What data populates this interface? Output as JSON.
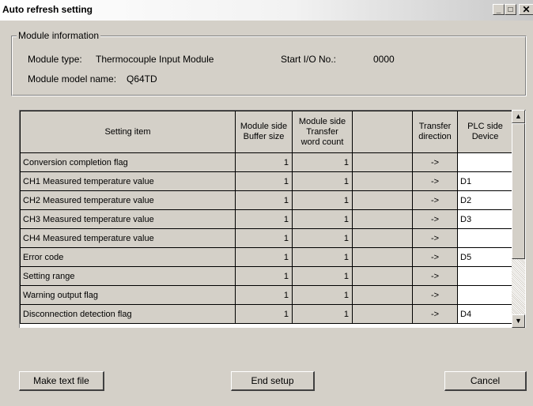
{
  "window": {
    "title": "Auto refresh setting",
    "min_glyph": "_",
    "max_glyph": "□",
    "close_glyph": "✕"
  },
  "module_info": {
    "legend": "Module information",
    "type_label": "Module type:",
    "type_value": "Thermocouple Input Module",
    "start_io_label": "Start I/O No.:",
    "start_io_value": "0000",
    "model_label": "Module model name:",
    "model_value": "Q64TD"
  },
  "table": {
    "headers": {
      "setting_item": "Setting item",
      "buffer_size": [
        "Module side",
        "Buffer size"
      ],
      "transfer_count": [
        "Module side",
        "Transfer",
        "word count"
      ],
      "blank": "",
      "direction": [
        "Transfer",
        "direction"
      ],
      "plc_device": [
        "PLC side",
        "Device"
      ]
    },
    "rows": [
      {
        "item": "Conversion completion flag",
        "buffer": "1",
        "count": "1",
        "blank": "",
        "direction": "->",
        "device": ""
      },
      {
        "item": "CH1 Measured temperature value",
        "buffer": "1",
        "count": "1",
        "blank": "",
        "direction": "->",
        "device": "D1"
      },
      {
        "item": "CH2 Measured temperature value",
        "buffer": "1",
        "count": "1",
        "blank": "",
        "direction": "->",
        "device": "D2"
      },
      {
        "item": "CH3 Measured temperature value",
        "buffer": "1",
        "count": "1",
        "blank": "",
        "direction": "->",
        "device": "D3"
      },
      {
        "item": "CH4 Measured temperature value",
        "buffer": "1",
        "count": "1",
        "blank": "",
        "direction": "->",
        "device": ""
      },
      {
        "item": "Error code",
        "buffer": "1",
        "count": "1",
        "blank": "",
        "direction": "->",
        "device": "D5"
      },
      {
        "item": "Setting range",
        "buffer": "1",
        "count": "1",
        "blank": "",
        "direction": "->",
        "device": ""
      },
      {
        "item": "Warning output flag",
        "buffer": "1",
        "count": "1",
        "blank": "",
        "direction": "->",
        "device": ""
      },
      {
        "item": "Disconnection detection flag",
        "buffer": "1",
        "count": "1",
        "blank": "",
        "direction": "->",
        "device": "D4"
      }
    ]
  },
  "scrollbar": {
    "up_glyph": "▲",
    "down_glyph": "▼"
  },
  "buttons": {
    "make_text_file": "Make text file",
    "end_setup": "End setup",
    "cancel": "Cancel"
  }
}
